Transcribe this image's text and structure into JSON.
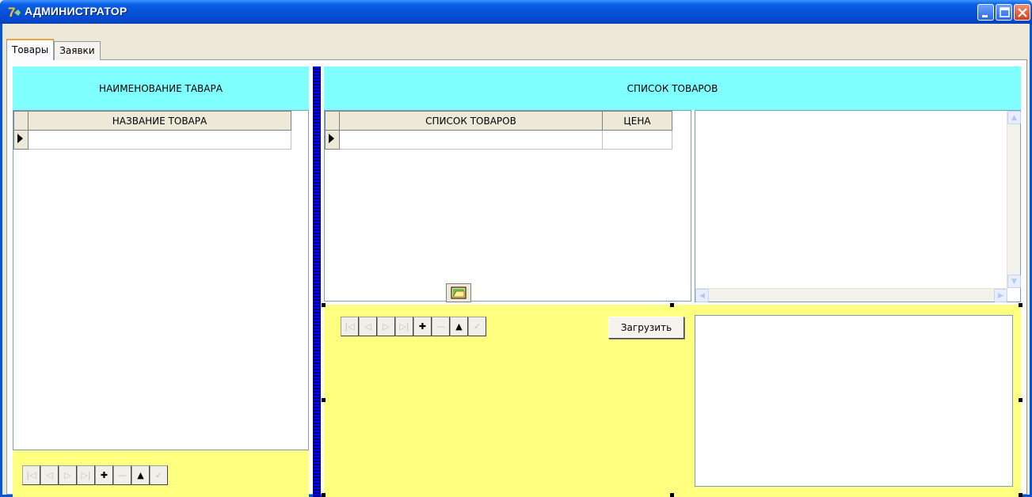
{
  "window": {
    "title": "АДМИНИСТРАТОР"
  },
  "tabs": [
    {
      "label": "Товары",
      "active": true
    },
    {
      "label": "Заявки",
      "active": false
    }
  ],
  "left_panel": {
    "header": "НАИМЕНОВАНИЕ ТАВАРА",
    "grid_columns": [
      "НАЗВАНИЕ ТОВАРА"
    ]
  },
  "right_panel": {
    "header": "СПИСОК ТОВАРОВ",
    "grid_columns": [
      "СПИСОК ТОВАРОВ",
      "ЦЕНА"
    ],
    "load_button": "Загрузить"
  },
  "navigator": {
    "buttons": [
      {
        "icon": "first-icon",
        "glyph": "|◁",
        "enabled": false
      },
      {
        "icon": "prior-icon",
        "glyph": "◁",
        "enabled": false
      },
      {
        "icon": "next-icon",
        "glyph": "▷",
        "enabled": false
      },
      {
        "icon": "last-icon",
        "glyph": "▷|",
        "enabled": false
      },
      {
        "icon": "insert-icon",
        "glyph": "✚",
        "enabled": true
      },
      {
        "icon": "delete-icon",
        "glyph": "—",
        "enabled": false
      },
      {
        "icon": "edit-icon",
        "glyph": "▲",
        "enabled": true
      },
      {
        "icon": "post-icon",
        "glyph": "✓",
        "enabled": false
      }
    ]
  },
  "colors": {
    "header": "#80FFFF",
    "panel": "#FFFF80",
    "splitter": "#0000FF"
  }
}
